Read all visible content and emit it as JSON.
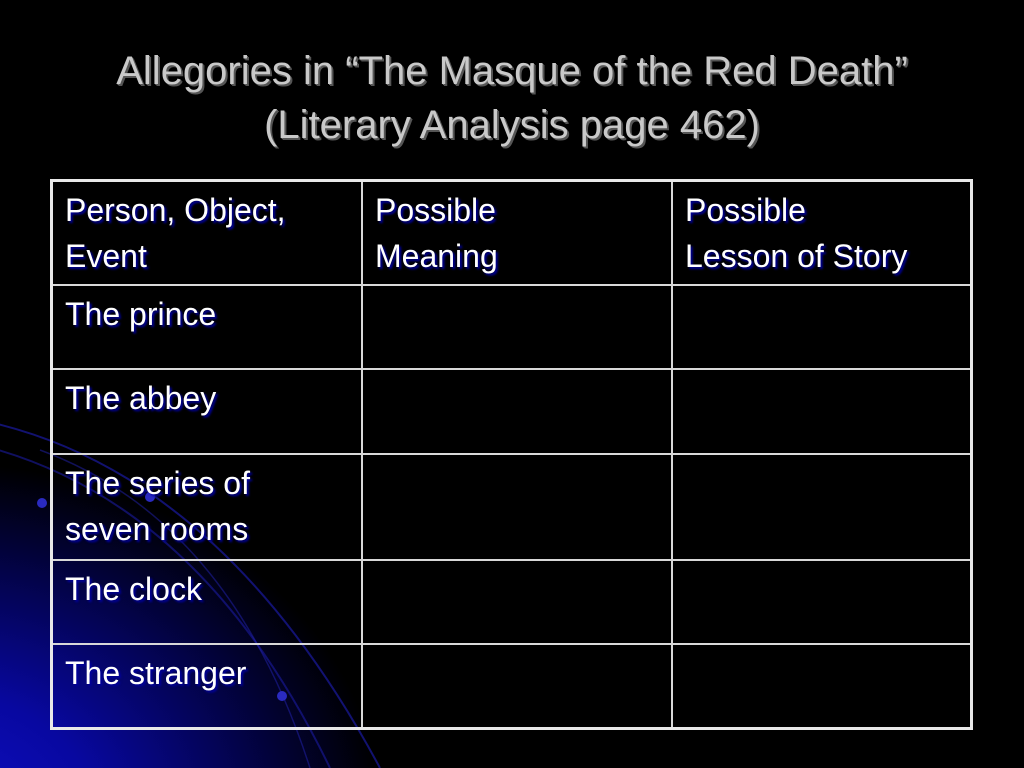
{
  "slide": {
    "title_line1": "Allegories in “The Masque of the Red Death”",
    "title_line2": "(Literary Analysis page 462)",
    "colors": {
      "background": "#000000",
      "accent": "#0a0ab4",
      "title": "#c9c9c9",
      "text": "#ffffff"
    }
  },
  "table": {
    "headers": [
      "Person, Object, Event",
      "Possible Meaning",
      "Possible Lesson of Story"
    ],
    "header_lines": [
      [
        "Person, Object,",
        "Event"
      ],
      [
        "Possible",
        "Meaning"
      ],
      [
        "Possible",
        "Lesson of Story"
      ]
    ],
    "rows": [
      {
        "item": "The prince",
        "meaning": "",
        "lesson": ""
      },
      {
        "item": "The abbey",
        "meaning": "",
        "lesson": ""
      },
      {
        "item_lines": [
          "The series of",
          "seven rooms"
        ],
        "item": "The series of seven rooms",
        "meaning": "",
        "lesson": ""
      },
      {
        "item": "The clock",
        "meaning": "",
        "lesson": ""
      },
      {
        "item": "The stranger",
        "meaning": "",
        "lesson": ""
      }
    ]
  }
}
